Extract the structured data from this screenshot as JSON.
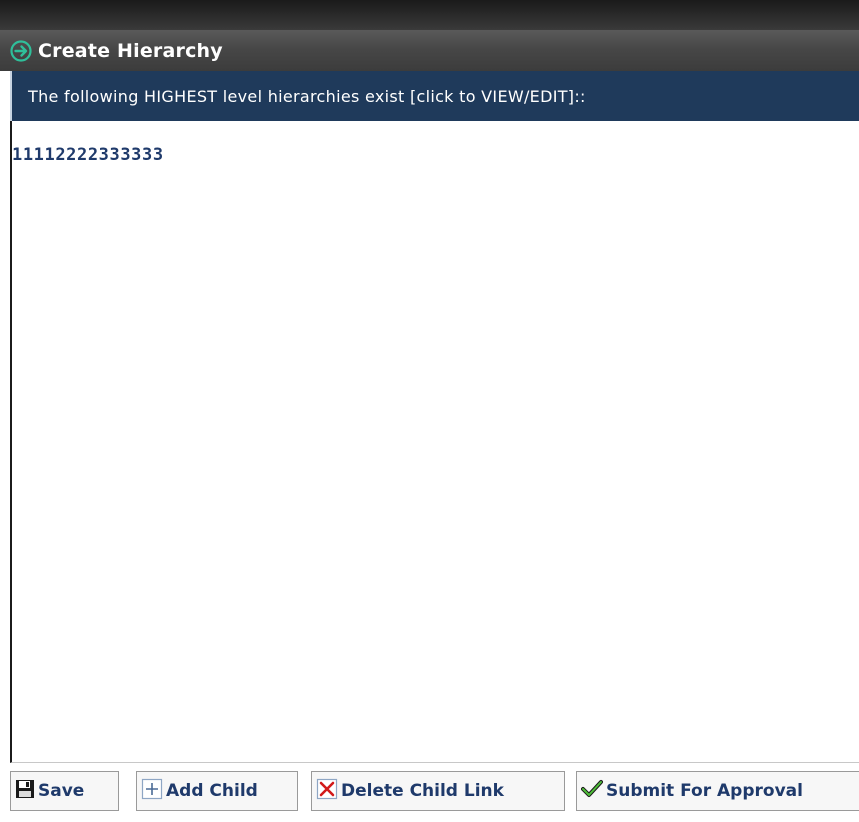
{
  "window": {
    "title": "Create Hierarchy",
    "title_icon": "arrow-circle-right-icon"
  },
  "info_bar": {
    "text": "The following HIGHEST level hierarchies exist [click to VIEW/EDIT]::"
  },
  "hierarchies": [
    {
      "label": "11112222333333"
    }
  ],
  "toolbar": {
    "save_label": "Save",
    "add_child_label": "Add Child",
    "delete_child_link_label": "Delete Child Link",
    "submit_for_approval_label": "Submit For Approval",
    "icons": {
      "save": "floppy-disk-icon",
      "add_child": "plus-icon",
      "delete_child_link": "red-x-icon",
      "submit_for_approval": "green-checkmark-icon"
    }
  },
  "colors": {
    "title_bar": "#474747",
    "info_bar": "#1f3a5b",
    "link_text": "#1f3a6b",
    "delete_icon": "#d21a1a",
    "check_icon": "#2e8b2e",
    "title_icon": "#2fbf9a"
  }
}
